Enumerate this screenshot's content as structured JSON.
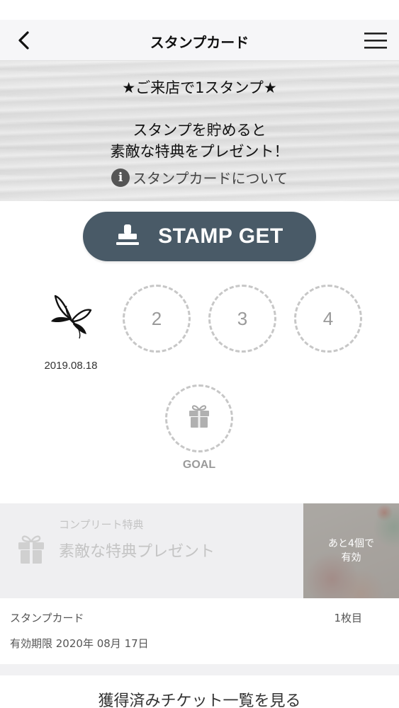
{
  "header": {
    "title": "スタンプカード",
    "back_icon": "chevron-left-icon",
    "menu_icon": "hamburger-menu-icon"
  },
  "hero": {
    "line1": "★ご来店で1スタンプ★",
    "line2": "スタンプを貯めると",
    "line3": "素敵な特典をプレゼント！",
    "about_link": "スタンプカードについて",
    "about_icon": "info-icon",
    "info_glyph": "i"
  },
  "stamp_button": {
    "label": "STAMP GET",
    "icon": "stamp-icon"
  },
  "stamps": {
    "slots": [
      {
        "number": "1",
        "filled": true,
        "date": "2019.08.18",
        "icon": "butterfly-icon"
      },
      {
        "number": "2",
        "filled": false
      },
      {
        "number": "3",
        "filled": false
      },
      {
        "number": "4",
        "filled": false
      }
    ],
    "goal_label": "GOAL",
    "goal_icon": "gift-icon"
  },
  "complete": {
    "caption": "コンプリート特典",
    "title": "素敵な特典プレゼント",
    "thumb_line1": "あと4個で",
    "thumb_line2": "有効"
  },
  "card_info": {
    "label": "スタンプカード",
    "count": "1枚目",
    "expiry": "有効期限 2020年 08月 17日"
  },
  "footer": {
    "tickets_link": "獲得済みチケット一覧を見る"
  },
  "colors": {
    "button": "#495a67",
    "slot_border": "#c7c7c7",
    "muted_text": "#9a9a9a"
  }
}
